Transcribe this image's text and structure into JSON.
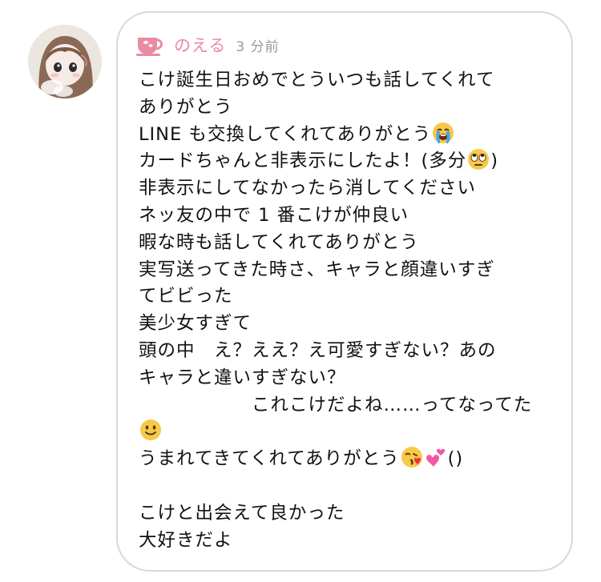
{
  "message": {
    "sender": {
      "name": "のえる",
      "icon": "teacup-icon",
      "accent_color": "#e98aa0"
    },
    "timestamp": "3 分前",
    "lines": {
      "l1": "こけ誕生日おめでとういつも話してくれて",
      "l2": "ありがとう",
      "l3a": "LINE も交換してくれてありがとう",
      "l4a": "カードちゃんと非表示にしたよ！(多分",
      "l4b": ")",
      "l5": "非表示にしてなかったら消してください",
      "l6": "ネッ友の中で 1 番こけが仲良い",
      "l7": "暇な時も話してくれてありがとう",
      "l8": "実写送ってきた時さ、キャラと顔違いすぎ",
      "l9": "てビビった",
      "l10": "美少女すぎて",
      "l11": "頭の中　え？ええ？え可愛すぎない？あの",
      "l12": "キャラと違いすぎない？",
      "l13": "　　　　　　これこけだよね……ってなってた",
      "l15a": "うまれてきてくれてありがとう",
      "l15b": "()",
      "l17": "こけと出会えて良かった",
      "l18": "大好きだよ"
    },
    "emojis": {
      "crying": "loudly-crying-face-emoji",
      "eyeroll": "face-with-rolling-eyes-emoji",
      "smile": "slightly-smiling-face-emoji",
      "kiss": "face-blowing-a-kiss-emoji",
      "hearts": "two-hearts-emoji"
    }
  }
}
